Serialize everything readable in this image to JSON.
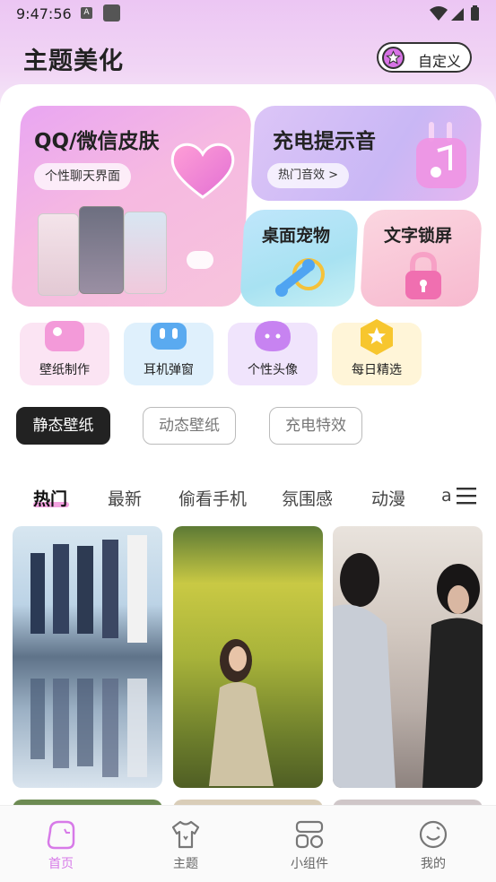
{
  "status_bar": {
    "time": "9:47:56",
    "notif_icon_letter": "A"
  },
  "header": {
    "title": "主题美化",
    "custom_button": "自定义"
  },
  "features": {
    "qq": {
      "title": "QQ/微信皮肤",
      "pill": "个性聊天界面"
    },
    "charge": {
      "title": "充电提示音",
      "pill": "热门音效 >"
    },
    "pet": {
      "title": "桌面宠物"
    },
    "lock": {
      "title": "文字锁屏"
    }
  },
  "quick_actions": [
    {
      "label": "壁纸制作",
      "icon": "image-icon",
      "color": "#f7cde9"
    },
    {
      "label": "耳机弹窗",
      "icon": "earbuds-icon",
      "color": "#cfe9fb"
    },
    {
      "label": "个性头像",
      "icon": "chat-bubble-icon",
      "color": "#e8d6fa"
    },
    {
      "label": "每日精选",
      "icon": "star-badge-icon",
      "color": "#fff0c4"
    }
  ],
  "wallpaper_types": [
    "静态壁纸",
    "动态壁纸",
    "充电特效"
  ],
  "categories": [
    "热门",
    "最新",
    "偷看手机",
    "氛围感",
    "动漫",
    "a"
  ],
  "bottom_nav": [
    "首页",
    "主题",
    "小组件",
    "我的"
  ],
  "colors": {
    "accent": "#d77ae8"
  }
}
